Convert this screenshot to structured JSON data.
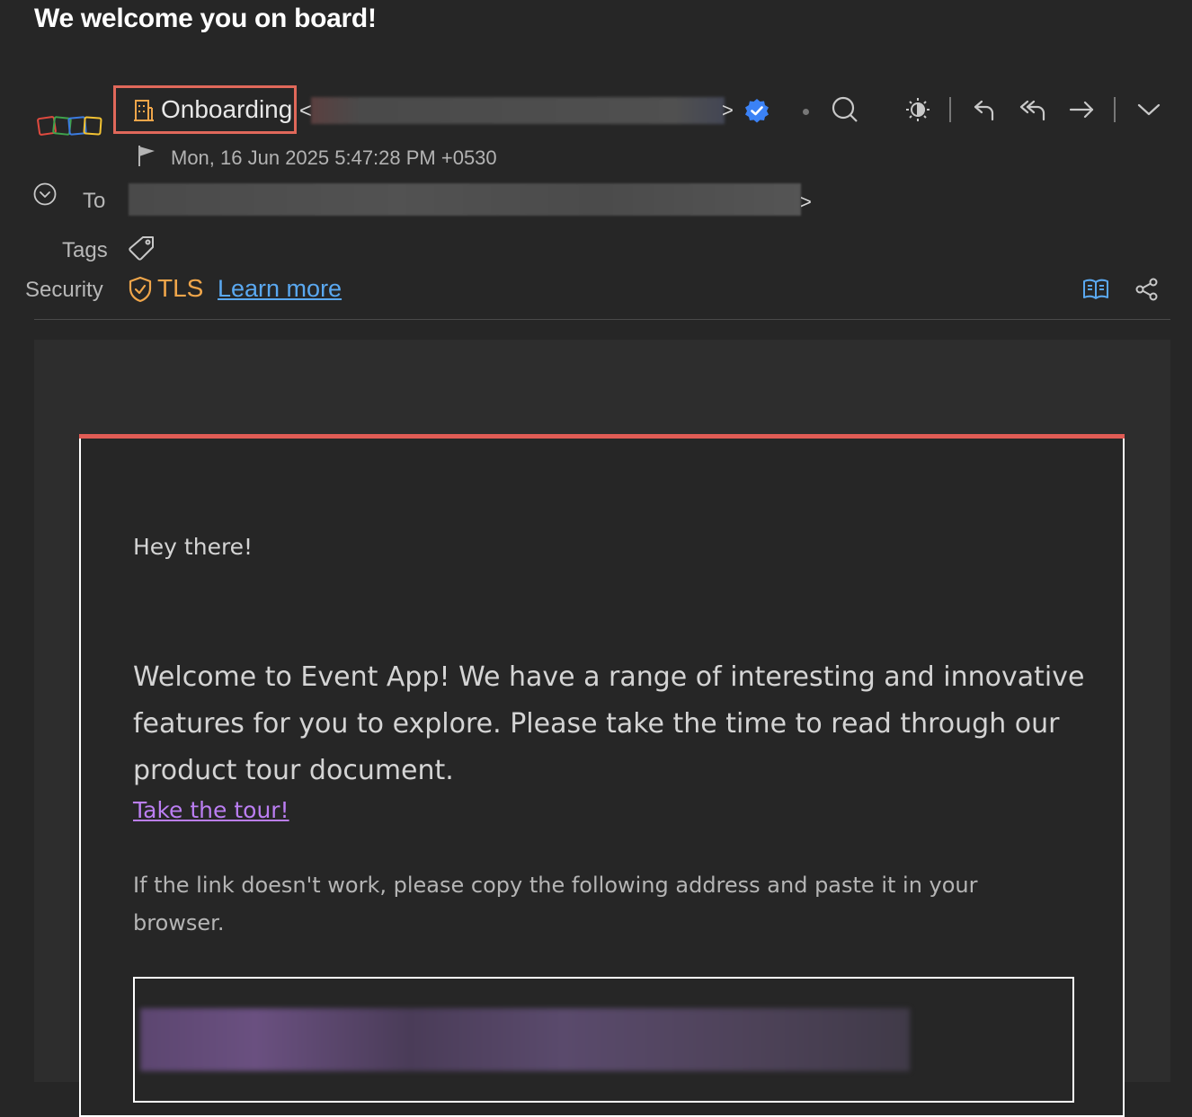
{
  "email": {
    "subject": "We welcome you on board!",
    "sender_name": "Onboarding",
    "sender_email_open": "<",
    "sender_email_close": ">",
    "date": "Mon, 16 Jun 2025 5:47:28 PM +0530",
    "to_label": "To",
    "to_close": ">",
    "tags_label": "Tags",
    "security_label": "Security",
    "security_value": "TLS",
    "learn_more": "Learn more"
  },
  "toolbar": {
    "icons": [
      "search-icon",
      "theme-toggle-icon",
      "reply-icon",
      "reply-all-icon",
      "forward-icon",
      "more-chevron-icon"
    ]
  },
  "body": {
    "greeting": "Hey there!",
    "welcome": "Welcome to Event App! We have a range of interesting and innovative features for you to explore. Please take the time to read through our product tour document.",
    "tour_link": "Take the tour!",
    "fallback_note": "If the link doesn't work, please copy the following address and paste it in your browser."
  },
  "colors": {
    "background": "#262626",
    "sender_highlight": "#e0685a",
    "tls": "#f0a64a",
    "link": "#5aa8f0",
    "tour_link": "#bb7ef2",
    "card_accent": "#e05c55",
    "verified": "#3b82f6"
  }
}
